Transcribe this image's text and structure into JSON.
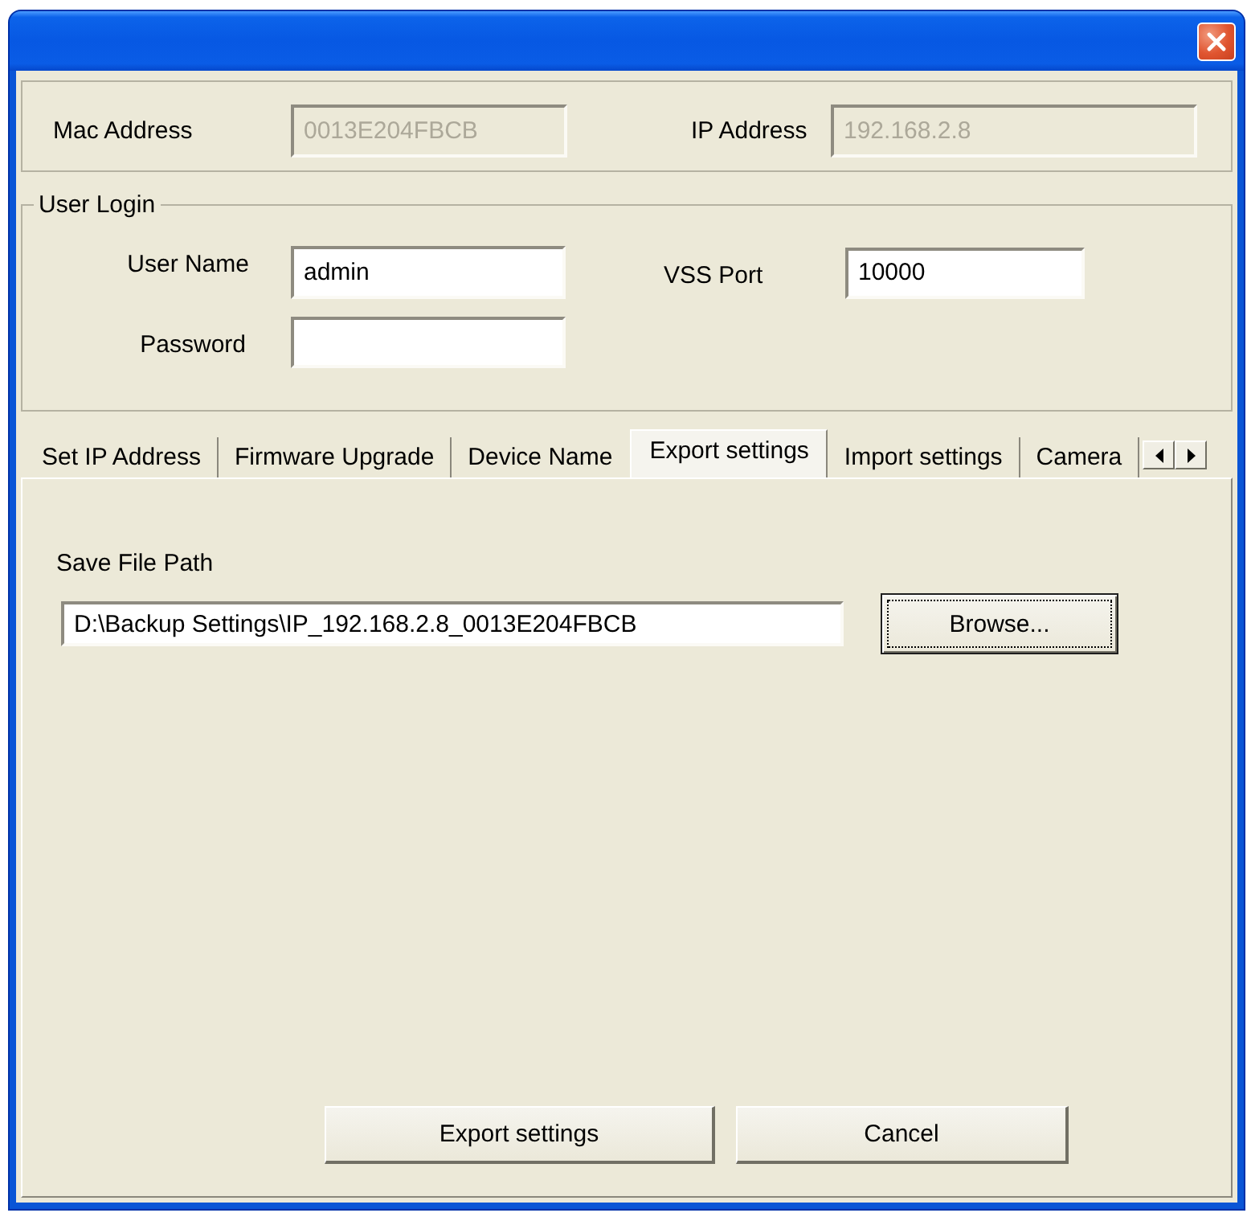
{
  "address_group": {
    "fields": [
      {
        "label": "Mac Address",
        "value": "0013E204FBCB",
        "disabled": true
      },
      {
        "label": "IP Address",
        "value": "192.168.2.8",
        "disabled": true
      }
    ]
  },
  "user_login": {
    "title": "User Login",
    "fields": [
      {
        "label": "User Name",
        "value": "admin",
        "disabled": false
      },
      {
        "label": "VSS Port",
        "value": "10000",
        "disabled": false
      },
      {
        "label": "Password",
        "disabled": false
      }
    ]
  },
  "tabs": [
    {
      "label": "Set IP Address",
      "selected": false
    },
    {
      "label": "Firmware Upgrade",
      "selected": false
    },
    {
      "label": "Device Name",
      "selected": false
    },
    {
      "label": "Export settings",
      "selected": true
    },
    {
      "label": "Import settings",
      "selected": false
    },
    {
      "label": "Camera",
      "selected": false
    }
  ],
  "export_panel": {
    "path_label": "Save File Path",
    "path_value": "D:\\Backup Settings\\IP_192.168.2.8_0013E204FBCB",
    "browse": {
      "label": "Browse...",
      "focused": true
    }
  },
  "buttons": [
    "Export settings",
    "Cancel"
  ]
}
